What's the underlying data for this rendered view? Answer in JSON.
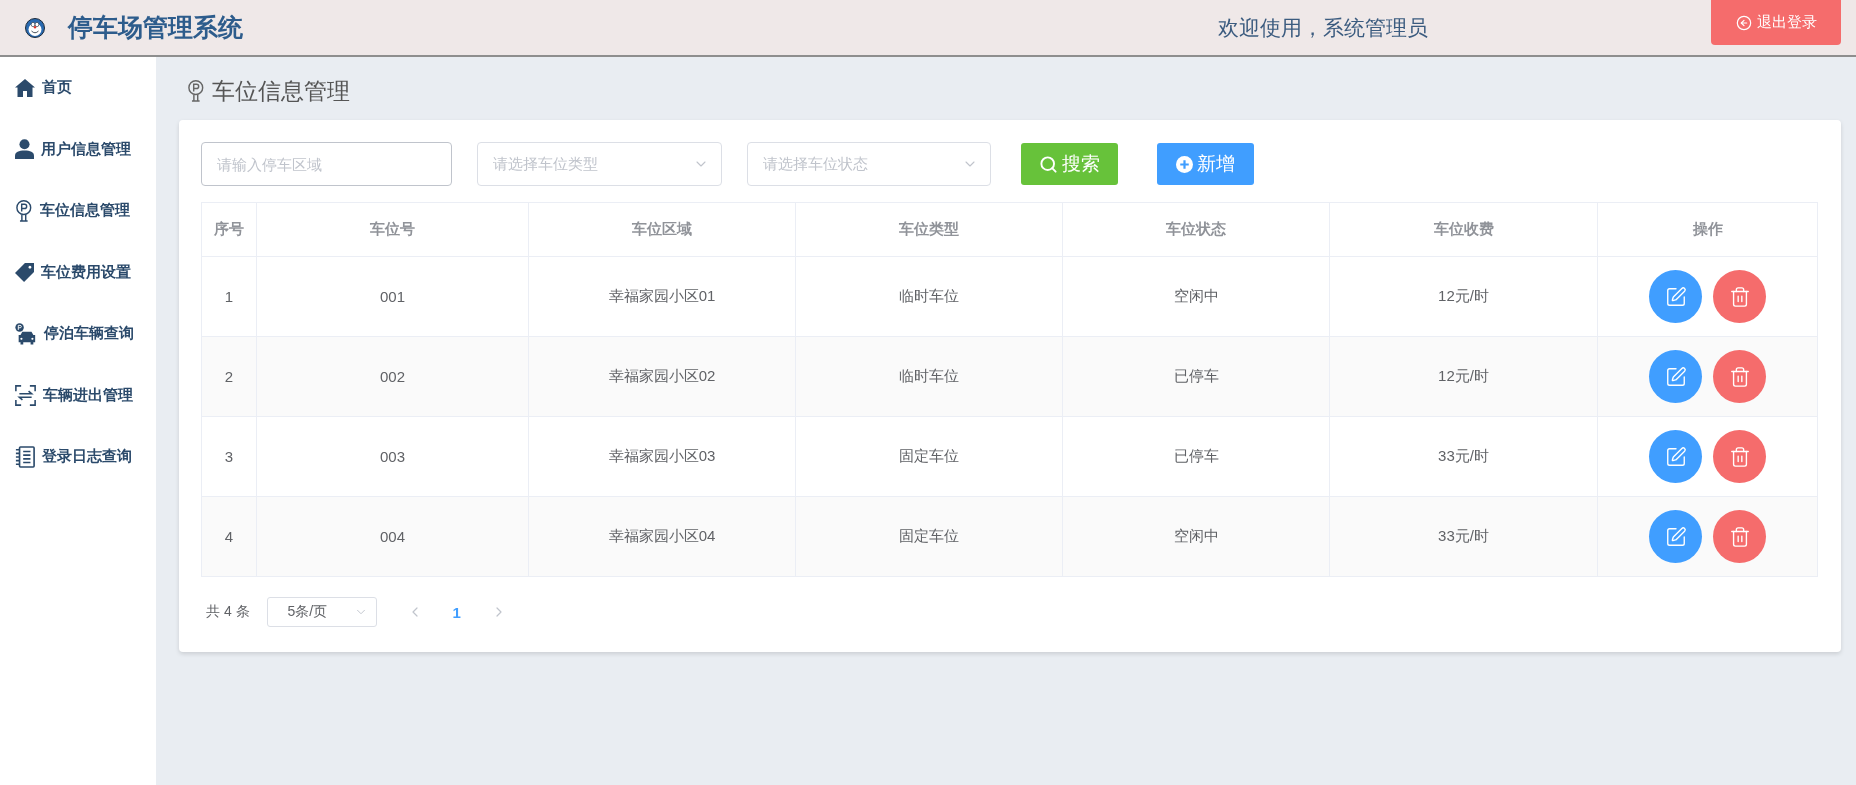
{
  "header": {
    "title": "停车场管理系统",
    "welcome": "欢迎使用，系统管理员",
    "logout_button": "退出登录"
  },
  "sidebar": {
    "items": [
      {
        "kind": "home",
        "label": "首页"
      },
      {
        "kind": "user",
        "label": "用户信息管理"
      },
      {
        "kind": "parking",
        "label": "车位信息管理"
      },
      {
        "kind": "tag",
        "label": "车位费用设置"
      },
      {
        "kind": "car",
        "label": "停泊车辆查询"
      },
      {
        "kind": "transfer",
        "label": "车辆进出管理"
      },
      {
        "kind": "notebook",
        "label": "登录日志查询"
      }
    ]
  },
  "page_title": "车位信息管理",
  "filters": [
    {
      "kind": "input",
      "placeholder": "请输入停车区域"
    },
    {
      "kind": "select",
      "placeholder": "请选择车位类型"
    },
    {
      "kind": "select",
      "placeholder": "请选择车位状态"
    }
  ],
  "buttons": [
    {
      "kind": "search",
      "label": "搜索"
    },
    {
      "kind": "add",
      "label": "新增"
    }
  ],
  "table": {
    "columns": [
      "序号",
      "车位号",
      "车位区域",
      "车位类型",
      "车位状态",
      "车位收费",
      "操作"
    ],
    "rows": [
      {
        "cells": [
          "1",
          "001",
          "幸福家园小区01",
          "临时车位",
          "空闲中",
          "12元/时"
        ]
      },
      {
        "cells": [
          "2",
          "002",
          "幸福家园小区02",
          "临时车位",
          "已停车",
          "12元/时"
        ]
      },
      {
        "cells": [
          "3",
          "003",
          "幸福家园小区03",
          "固定车位",
          "已停车",
          "33元/时"
        ]
      },
      {
        "cells": [
          "4",
          "004",
          "幸福家园小区04",
          "固定车位",
          "空闲中",
          "33元/时"
        ]
      }
    ]
  },
  "pagination": {
    "total": "共 4 条",
    "page_size": "5条/页",
    "pages": [
      {
        "label": "1",
        "selected": true
      }
    ]
  }
}
